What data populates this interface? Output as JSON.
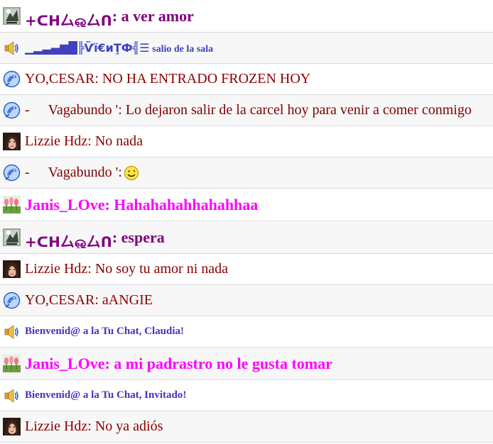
{
  "messages": [
    {
      "type": "user",
      "icon": "chess-avatar-icon",
      "name": "+ᑕᕼ厶ஓ厶ᑎ",
      "sep": ":",
      "text": " a ver amor",
      "style": "purple"
    },
    {
      "type": "system",
      "icon": "speaker-icon",
      "name": "▁▂▃▄▆█╠Ѷї€иŢФ╣☰",
      "text": " salio de la sala",
      "style": "sys"
    },
    {
      "type": "user",
      "icon": "dolphin-avatar-icon",
      "name": "YO,CESAR",
      "sep": ":",
      "text": " NO HA ENTRADO FROZEN HOY",
      "style": "dark"
    },
    {
      "type": "user",
      "icon": "dolphin-avatar-icon",
      "name": "-",
      "gap": true,
      "sep": "",
      "text": "Vagabundo ': Lo dejaron salir de la carcel hoy para venir a comer conmigo",
      "style": "darkred"
    },
    {
      "type": "user",
      "icon": "woman-avatar-icon",
      "name": "Lizzie Hdz",
      "sep": ":",
      "text": " No nada",
      "style": "dark"
    },
    {
      "type": "user",
      "icon": "dolphin-avatar-icon",
      "name": "-",
      "gap": true,
      "sep": "",
      "text": "Vagabundo ':",
      "smiley": true,
      "style": "darkred"
    },
    {
      "type": "user",
      "icon": "tulips-avatar-icon",
      "name": "Janis_LOve",
      "sep": ":",
      "text": " Hahahahahhahahhaa",
      "style": "magenta"
    },
    {
      "type": "user",
      "icon": "chess-avatar-icon",
      "name": "+ᑕᕼ厶ஓ厶ᑎ",
      "sep": ":",
      "text": " espera",
      "style": "purple"
    },
    {
      "type": "user",
      "icon": "woman-avatar-icon",
      "name": "Lizzie Hdz",
      "sep": ":",
      "text": " No soy tu amor ni nada",
      "style": "dark"
    },
    {
      "type": "user",
      "icon": "dolphin-avatar-icon",
      "name": "YO,CESAR",
      "sep": ":",
      "text": " aANGIE",
      "style": "dark"
    },
    {
      "type": "system",
      "icon": "speaker-icon",
      "name": "",
      "text": "Bienvenid@ a la Tu Chat, Claudia!",
      "style": "sys2"
    },
    {
      "type": "user",
      "icon": "tulips-avatar-icon",
      "name": "Janis_LOve",
      "sep": ":",
      "text": " a mi padrastro no le gusta tomar",
      "style": "magenta"
    },
    {
      "type": "system",
      "icon": "speaker-icon",
      "name": "",
      "text": "Bienvenid@ a la Tu Chat, Invitado!",
      "style": "sys2"
    },
    {
      "type": "user",
      "icon": "woman-avatar-icon",
      "name": "Lizzie Hdz",
      "sep": ":",
      "text": " No ya adiós",
      "style": "dark"
    }
  ]
}
